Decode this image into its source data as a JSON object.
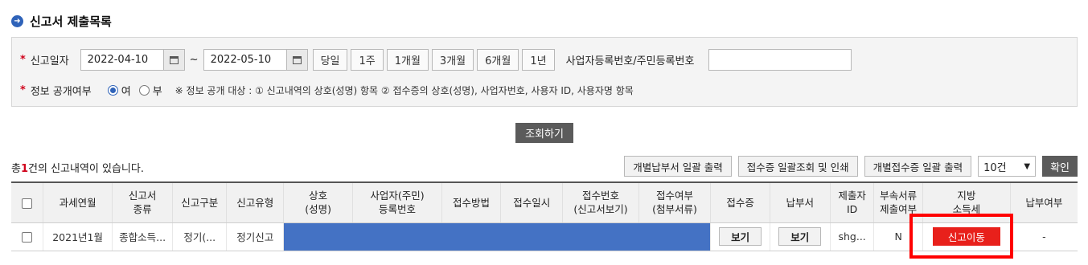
{
  "page": {
    "title": "신고서 제출목록",
    "title_icon": "arrow-right-icon"
  },
  "search": {
    "date_label": "신고일자",
    "date_from": "2022-04-10",
    "date_to": "2022-05-10",
    "tilde": "~",
    "period_buttons": [
      "당일",
      "1주",
      "1개월",
      "3개월",
      "6개월",
      "1년"
    ],
    "id_label": "사업자등록번호/주민등록번호",
    "id_value": "",
    "disclosure_label": "정보 공개여부",
    "radio_yes": "여",
    "radio_no": "부",
    "radio_selected": "여",
    "notice": "※ 정보 공개 대상 : ① 신고내역의 상호(성명) 항목 ② 접수증의 상호(성명), 사업자번호, 사용자 ID, 사용자명 항목",
    "inquiry_button": "조회하기",
    "required_mark": "*"
  },
  "results": {
    "count_prefix": "총",
    "count": "1",
    "count_suffix": "건의 신고내역이 있습니다.",
    "toolbar": {
      "btn_payment_print": "개별납부서 일괄 출력",
      "btn_receipt_print": "접수증 일괄조회 및 인쇄",
      "btn_individual_receipt": "개별접수증 일괄 출력",
      "page_size": "10건",
      "confirm": "확인"
    }
  },
  "table": {
    "headers": [
      "",
      "과세연월",
      "신고서\n종류",
      "신고구분",
      "신고유형",
      "상호\n(성명)",
      "사업자(주민)\n등록번호",
      "접수방법",
      "접수일시",
      "접수번호\n(신고서보기)",
      "접수여부\n(첨부서류)",
      "접수증",
      "납부서",
      "제출자\nID",
      "부속서류\n제출여부",
      "지방\n소득세",
      "납부여부"
    ],
    "row": {
      "period": "2021년1월",
      "form_type": "종합소득...",
      "category": "정기(...",
      "report_type": "정기신고",
      "receipt_view": "보기",
      "payment_view": "보기",
      "submitter_id": "shg...",
      "attachment": "N",
      "local_tax_button": "신고이동",
      "paid": "-"
    }
  },
  "colors": {
    "accent_blue": "#2f63b9",
    "masked_blue": "#4472c4",
    "red_button": "#e8201b",
    "highlight_red": "#ff0000"
  }
}
